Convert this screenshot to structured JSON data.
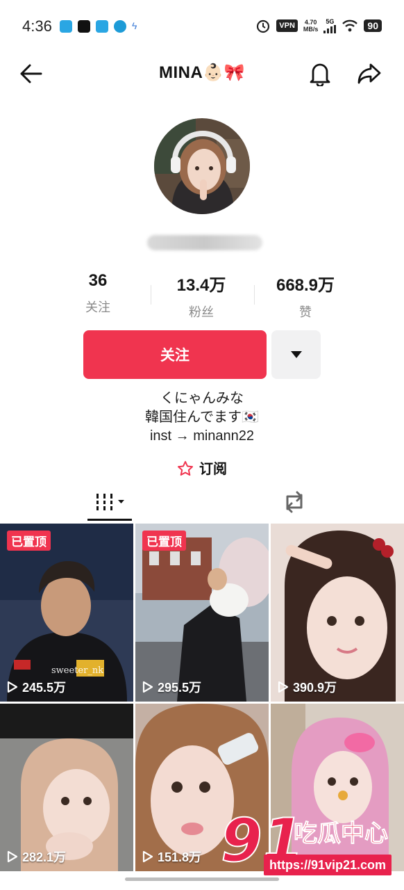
{
  "status_bar": {
    "time": "4:36",
    "vpn": "VPN",
    "speed_value": "4.70",
    "speed_unit": "MB/s",
    "network": "5G",
    "battery": "90"
  },
  "header": {
    "title": "MINA👶🏻🎀",
    "back_icon": "arrow-left-icon",
    "bell_icon": "bell-icon",
    "share_icon": "share-icon"
  },
  "stats": [
    {
      "value": "36",
      "label": "关注"
    },
    {
      "value": "13.4万",
      "label": "粉丝"
    },
    {
      "value": "668.9万",
      "label": "赞"
    }
  ],
  "actions": {
    "follow_label": "关注",
    "more_icon": "caret-down-icon"
  },
  "bio": {
    "line1": "くにゃんみな",
    "line2": "韓国住んでます🇰🇷",
    "line3": "inst → minann22"
  },
  "subscribe": {
    "label": "订阅"
  },
  "tabs": {
    "videos_icon": "grid-icon",
    "reposts_icon": "repost-icon"
  },
  "videos": [
    {
      "pinned": "已置顶",
      "views": "245.5万",
      "overlay": "sweeter_nk"
    },
    {
      "pinned": "已置顶",
      "views": "295.5万"
    },
    {
      "views": "390.9万"
    },
    {
      "views": "282.1万"
    },
    {
      "views": "151.8万"
    },
    {
      "views": ""
    }
  ],
  "watermark": {
    "number": "91",
    "name": "吃瓜中心",
    "url": "https://91vip21.com"
  },
  "colors": {
    "accent": "#f0344f",
    "secondary_button": "#f1f1f2",
    "muted_text": "#8a8a8a"
  }
}
